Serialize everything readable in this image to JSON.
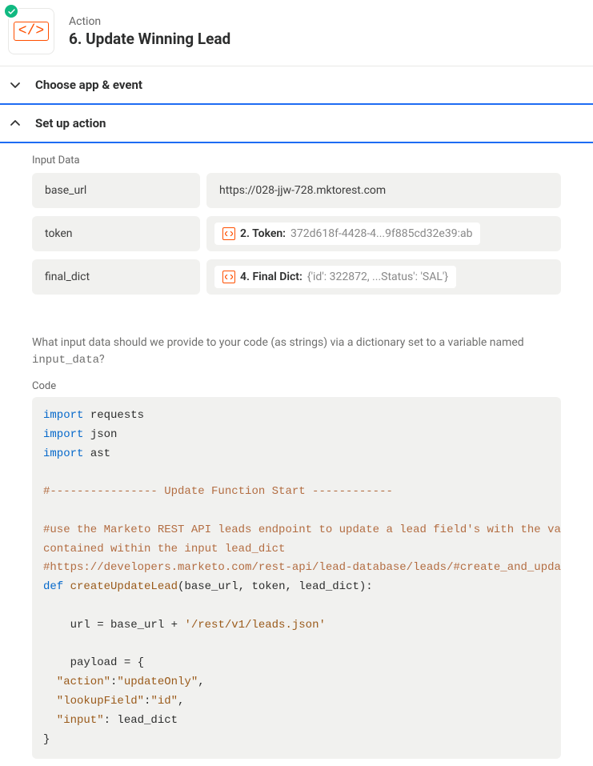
{
  "header": {
    "overline": "Action",
    "title": "6. Update Winning Lead",
    "code_glyph": "</>"
  },
  "sections": {
    "choose": {
      "label": "Choose app & event"
    },
    "setup": {
      "label": "Set up action"
    }
  },
  "input": {
    "heading": "Input Data",
    "rows": [
      {
        "key": "base_url",
        "value": "https://028-jjw-728.mktorest.com"
      },
      {
        "key": "token",
        "pill_label": "2. Token:",
        "pill_value": "372d618f-4428-4...9f885cd32e39:ab"
      },
      {
        "key": "final_dict",
        "pill_label": "4. Final Dict:",
        "pill_value": "{'id': 322872, ...Status': 'SAL'}"
      }
    ],
    "help": {
      "prefix": "What input data should we provide to your code (as strings) via a dictionary set to a variable named ",
      "var": "input_data",
      "suffix": "?"
    }
  },
  "code": {
    "label": "Code",
    "kw_import": "import",
    "kw_def": "def",
    "mod_requests": " requests",
    "mod_json": " json",
    "mod_ast": " ast",
    "c1": "#---------------- Update Function Start ------------",
    "c2": "#use the Marketo REST API leads endpoint to update a lead field's with the values",
    "c3": "contained within the input lead_dict",
    "c4": "#https://developers.marketo.com/rest-api/lead-database/leads/#create_and_update",
    "fn_name": " createUpdateLead",
    "fn_sig": "(base_url, token, lead_dict):",
    "l_url_a": "    url = base_url + ",
    "l_url_s": "'/rest/v1/leads.json'",
    "l_payload": "    payload = {",
    "l_action_k": "  \"action\"",
    "l_action_v": "\"updateOnly\"",
    "l_lookup_k": "  \"lookupField\"",
    "l_lookup_v": "\"id\"",
    "l_input_k": "  \"input\"",
    "l_input_v": ": lead_dict",
    "l_close": "}",
    "colon": ":",
    "comma": ","
  }
}
